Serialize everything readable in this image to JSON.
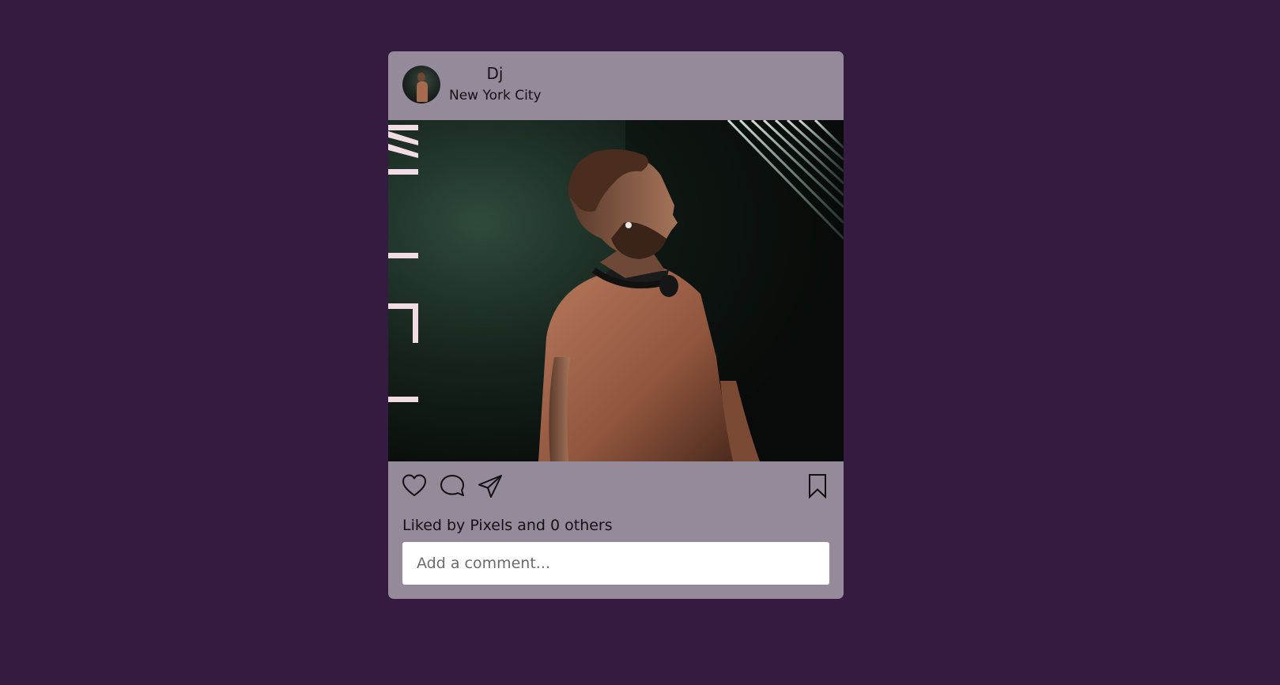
{
  "post": {
    "user": {
      "name": "Dj",
      "location": "New York City",
      "avatar_icon": "avatar-photo"
    },
    "image": {
      "subject": "dj-photo",
      "sign_letters": [
        "M",
        "I",
        "T",
        "I"
      ]
    },
    "actions": {
      "like_icon": "heart-icon",
      "comment_icon": "speech-bubble-icon",
      "share_icon": "paper-plane-icon",
      "save_icon": "bookmark-icon"
    },
    "likes_text": "Liked by Pixels and 0 others",
    "comment": {
      "placeholder": "Add a comment...",
      "value": ""
    }
  },
  "colors": {
    "background": "#341b3f",
    "card": "#958a9a",
    "text": "#151015",
    "input_bg": "#ffffff"
  }
}
